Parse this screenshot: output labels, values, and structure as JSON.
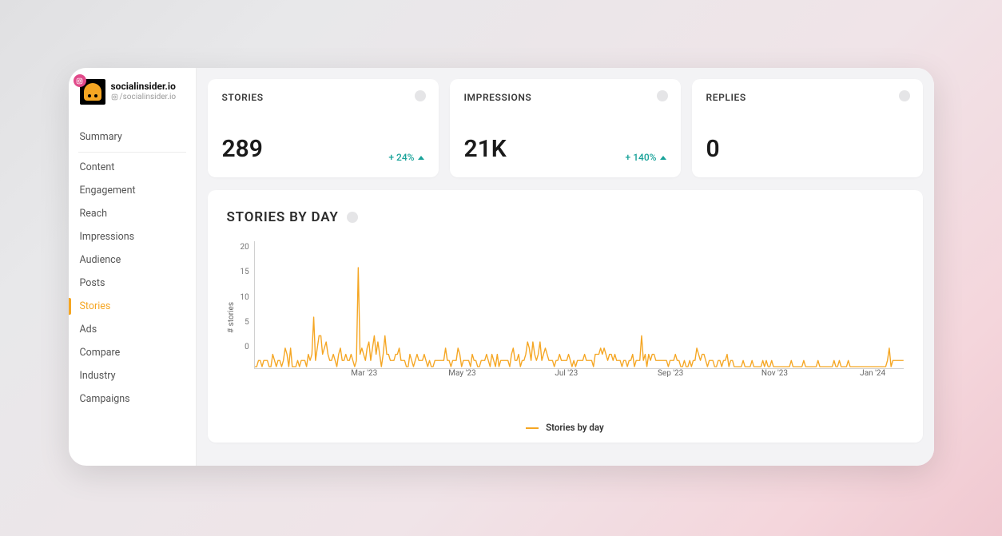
{
  "profile": {
    "name": "socialinsider.io",
    "handle": "/socialinsider.io",
    "platform_icon": "instagram-icon"
  },
  "sidebar": {
    "items": [
      {
        "label": "Summary"
      },
      {
        "label": "Content"
      },
      {
        "label": "Engagement"
      },
      {
        "label": "Reach"
      },
      {
        "label": "Impressions"
      },
      {
        "label": "Audience"
      },
      {
        "label": "Posts"
      },
      {
        "label": "Stories",
        "active": true
      },
      {
        "label": "Ads"
      },
      {
        "label": "Compare"
      },
      {
        "label": "Industry"
      },
      {
        "label": "Campaigns"
      }
    ]
  },
  "metrics": {
    "stories": {
      "title": "STORIES",
      "value": "289",
      "delta": "+ 24%"
    },
    "impressions": {
      "title": "IMPRESSIONS",
      "value": "21K",
      "delta": "+ 140%"
    },
    "replies": {
      "title": "REPLIES",
      "value": "0",
      "delta": ""
    }
  },
  "chart": {
    "title": "STORIES BY DAY",
    "ylabel": "# stories",
    "legend": "Stories by day",
    "yticks": [
      "20",
      "15",
      "10",
      "5",
      "0"
    ],
    "xticks": [
      "Mar '23",
      "May '23",
      "Jul '23",
      "Sep '23",
      "Nov '23",
      "Jan '24"
    ]
  },
  "colors": {
    "accent": "#f5a623",
    "positive": "#1aa39a",
    "instagram": "#e14a8a"
  },
  "chart_data": {
    "type": "line",
    "title": "STORIES BY DAY",
    "xlabel": "",
    "ylabel": "# stories",
    "ylim": [
      0,
      20
    ],
    "x_range": [
      "2023-02-01",
      "2024-02-01"
    ],
    "x_tick_labels": [
      "Mar '23",
      "May '23",
      "Jul '23",
      "Sep '23",
      "Nov '23",
      "Jan '24"
    ],
    "series": [
      {
        "name": "Stories by day",
        "color": "#f5a623",
        "values": [
          0,
          0,
          1,
          1,
          0,
          1,
          1,
          1,
          0,
          0,
          2,
          1,
          0,
          1,
          1,
          0,
          1,
          3,
          2,
          0,
          3,
          0,
          0,
          0,
          1,
          0,
          1,
          1,
          1,
          0,
          2,
          1,
          2,
          8,
          1,
          3,
          5,
          5,
          2,
          3,
          4,
          2,
          1,
          1,
          2,
          1,
          0,
          2,
          3,
          1,
          1,
          2,
          1,
          1,
          2,
          1,
          0,
          1,
          16,
          2,
          3,
          2,
          1,
          3,
          4,
          1,
          3,
          5,
          2,
          4,
          2,
          0,
          2,
          5,
          2,
          2,
          1,
          1,
          1,
          2,
          2,
          3,
          1,
          1,
          1,
          0,
          0,
          2,
          1,
          0,
          1,
          2,
          1,
          1,
          1,
          2,
          1,
          0,
          1,
          0,
          0,
          1,
          1,
          1,
          1,
          1,
          1,
          3,
          1,
          1,
          0,
          1,
          1,
          1,
          3,
          2,
          0,
          1,
          1,
          1,
          1,
          0,
          2,
          1,
          1,
          0,
          0,
          1,
          1,
          1,
          2,
          1,
          0,
          2,
          1,
          0,
          2,
          0,
          1,
          1,
          1,
          1,
          1,
          0,
          2,
          3,
          1,
          1,
          2,
          0,
          1,
          1,
          2,
          4,
          3,
          1,
          4,
          2,
          1,
          2,
          4,
          1,
          2,
          3,
          2,
          1,
          1,
          1,
          0,
          1,
          1,
          2,
          1,
          1,
          1,
          1,
          2,
          1,
          0,
          1,
          0,
          1,
          1,
          1,
          1,
          2,
          1,
          1,
          1,
          1,
          0,
          2,
          2,
          2,
          3,
          2,
          3,
          2,
          1,
          2,
          2,
          1,
          2,
          1,
          1,
          1,
          0,
          1,
          1,
          0,
          1,
          1,
          2,
          0,
          1,
          1,
          1,
          5,
          1,
          2,
          0,
          2,
          1,
          2,
          2,
          1,
          1,
          1,
          1,
          1,
          1,
          1,
          0,
          1,
          1,
          1,
          2,
          1,
          1,
          0,
          0,
          1,
          0,
          0,
          1,
          0,
          1,
          1,
          3,
          2,
          1,
          2,
          2,
          1,
          0,
          1,
          1,
          1,
          0,
          0,
          1,
          1,
          0,
          1,
          1,
          2,
          0,
          1,
          1,
          0,
          0,
          0,
          0,
          0,
          1,
          0,
          0,
          0,
          0,
          1,
          0,
          0,
          0,
          0,
          0,
          1,
          0,
          1,
          0,
          0,
          1,
          0,
          0,
          0,
          0,
          0,
          0,
          0,
          0,
          0,
          0,
          1,
          0,
          0,
          0,
          0,
          0,
          0,
          1,
          0,
          0,
          0,
          0,
          0,
          0,
          0,
          1,
          0,
          0,
          0,
          0,
          0,
          0,
          0,
          0,
          1,
          0,
          0,
          1,
          0,
          0,
          0,
          0,
          1,
          0,
          0,
          0,
          0,
          0,
          0,
          0,
          0,
          0,
          0,
          0,
          0,
          0,
          0,
          0,
          0,
          0,
          0,
          0,
          0,
          0,
          1,
          3,
          0,
          1,
          1,
          1,
          1,
          1,
          1,
          1
        ]
      }
    ]
  }
}
